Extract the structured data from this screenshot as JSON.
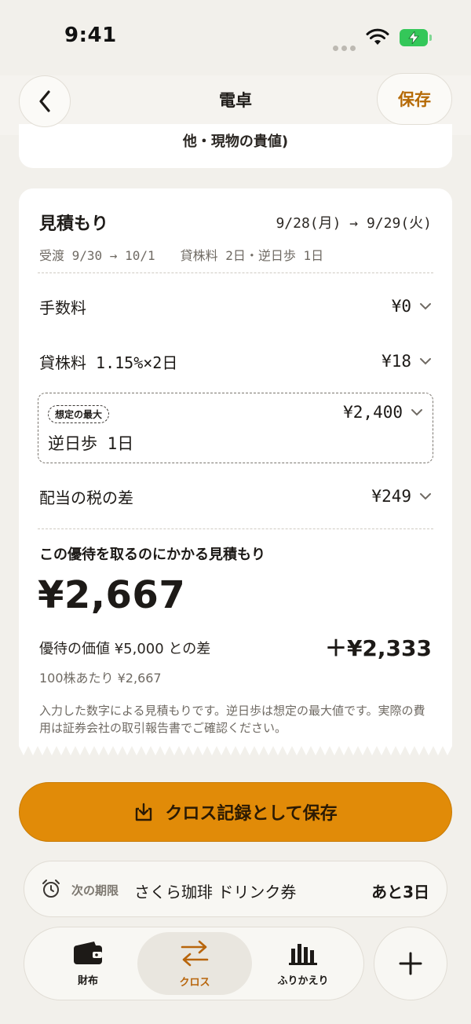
{
  "status_bar": {
    "time": "9:41"
  },
  "nav": {
    "title": "電卓",
    "save_label": "保存"
  },
  "prev_card": {
    "text_tail": "他・現物の貴値)"
  },
  "estimate": {
    "title": "見積もり",
    "dates": "9/28(月) → 9/29(火)",
    "settlement": "受渡 9/30 → 10/1",
    "rental_info": "貸株料 2日・逆日歩 1日",
    "rows": {
      "fee": {
        "label": "手数料",
        "value": "¥0"
      },
      "rental": {
        "label": "貸株料 1.15%×2日",
        "value": "¥18"
      },
      "reverse": {
        "badge": "想定の最大",
        "label": "逆日歩 1日",
        "value": "¥2,400"
      },
      "dividend_tax": {
        "label": "配当の税の差",
        "value": "¥249"
      }
    },
    "total_caption": "この優待を取るのにかかる見積もり",
    "total_amount": "¥2,667",
    "diff_label": "優待の価値 ¥5,000 との差",
    "diff_amount": "＋¥2,333",
    "per_100": "100株あたり ¥2,667",
    "note": "入力した数字による見積もりです。逆日歩は想定の最大値です。実際の費用は証券会社の取引報告書でご確認ください。"
  },
  "save_cross": {
    "label": "クロス記録として保存"
  },
  "deadline": {
    "caption": "次の期限",
    "name": "さくら珈琲 ドリンク券",
    "remaining": "あと3日"
  },
  "tabs": [
    {
      "label": "財布",
      "icon": "wallet-icon"
    },
    {
      "label": "クロス",
      "icon": "swap-arrows-icon"
    },
    {
      "label": "ふりかえり",
      "icon": "bar-chart-icon"
    }
  ],
  "colors": {
    "accent": "#e18b08",
    "accent_text": "#b56a06",
    "background": "#f2f0eb",
    "battery": "#34c759"
  }
}
